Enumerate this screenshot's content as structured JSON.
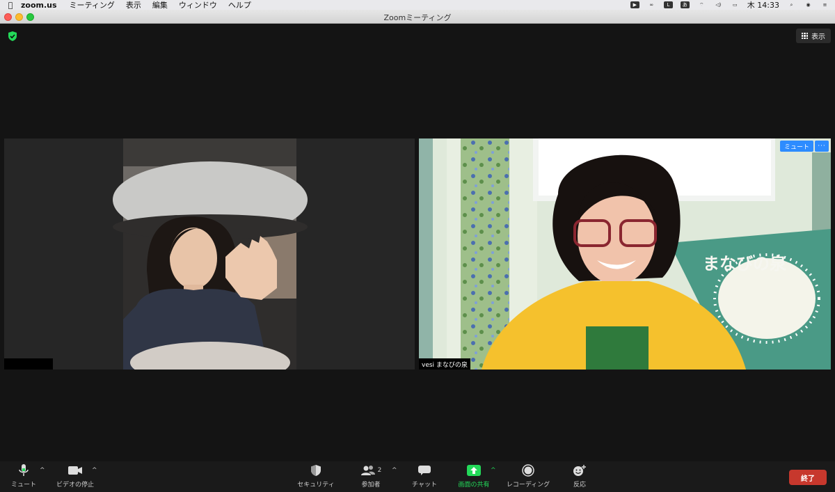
{
  "menubar": {
    "apple_icon": "apple-logo-icon",
    "app_name": "zoom.us",
    "items": [
      "ミーティング",
      "表示",
      "編集",
      "ウィンドウ",
      "ヘルプ"
    ],
    "status": {
      "ime": "あ",
      "clock": "木 14:33"
    }
  },
  "window": {
    "title": "Zoomミーティング"
  },
  "meeting": {
    "view_label": "表示",
    "participants": [
      {
        "name": ""
      },
      {
        "name": "vesi まなびの泉",
        "mute_label": "ミュート",
        "more_label": "···"
      }
    ],
    "poster_text": "まなびの泉"
  },
  "toolbar": {
    "mute": "ミュート",
    "video": "ビデオの停止",
    "security": "セキュリティ",
    "participants": "参加者",
    "participants_count": "2",
    "chat": "チャット",
    "share": "画面の共有",
    "record": "レコーディング",
    "reactions": "反応",
    "end": "終了"
  },
  "colors": {
    "accent": "#2d8cff",
    "share_green": "#23d959",
    "end_red": "#c7382d",
    "security_green": "#23d959"
  }
}
